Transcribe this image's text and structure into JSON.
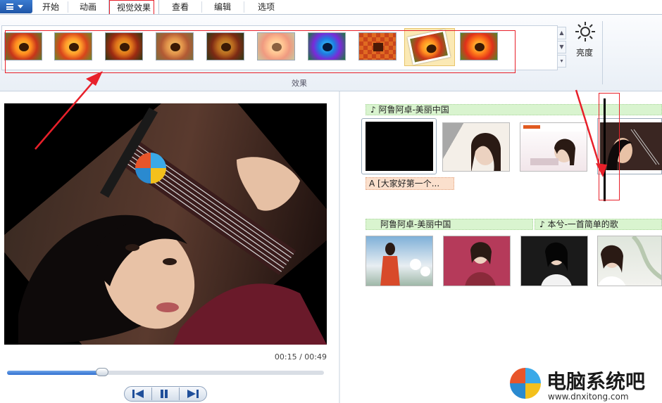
{
  "tabs": [
    {
      "id": "start",
      "label": "开始"
    },
    {
      "id": "anim",
      "label": "动画"
    },
    {
      "id": "visual",
      "label": "视觉效果",
      "active": true
    },
    {
      "id": "view",
      "label": "查看"
    },
    {
      "id": "edit",
      "label": "编辑"
    },
    {
      "id": "options",
      "label": "选项"
    }
  ],
  "ribbon": {
    "group_label": "效果",
    "brightness_label": "亮度",
    "effects_icons": [
      "flower-normal",
      "flower-warm",
      "flower-dark",
      "flower-sepia",
      "flower-dim",
      "flower-pale",
      "flower-blue",
      "flower-pixelate",
      "flower-rotate-selected",
      "flower-vivid"
    ]
  },
  "preview": {
    "time": "00:15 / 00:49",
    "progress": 0.3
  },
  "storyboard": {
    "row1_music": "♪ 阿鲁阿卓-美丽中国",
    "row1_caption": "A [大家好第一个...",
    "row2_music_a": "阿鲁阿卓-美丽中国",
    "row2_music_b": "♪ 本兮-一首简单的歌"
  },
  "watermark": {
    "site_name": "电脑系统吧",
    "url": "www.dnxitong.com"
  },
  "colors": {
    "accent": "#2f6fd0",
    "annotation": "#e8202a",
    "music_track": "#d9f4cf",
    "caption_track": "#fbe0cd"
  }
}
